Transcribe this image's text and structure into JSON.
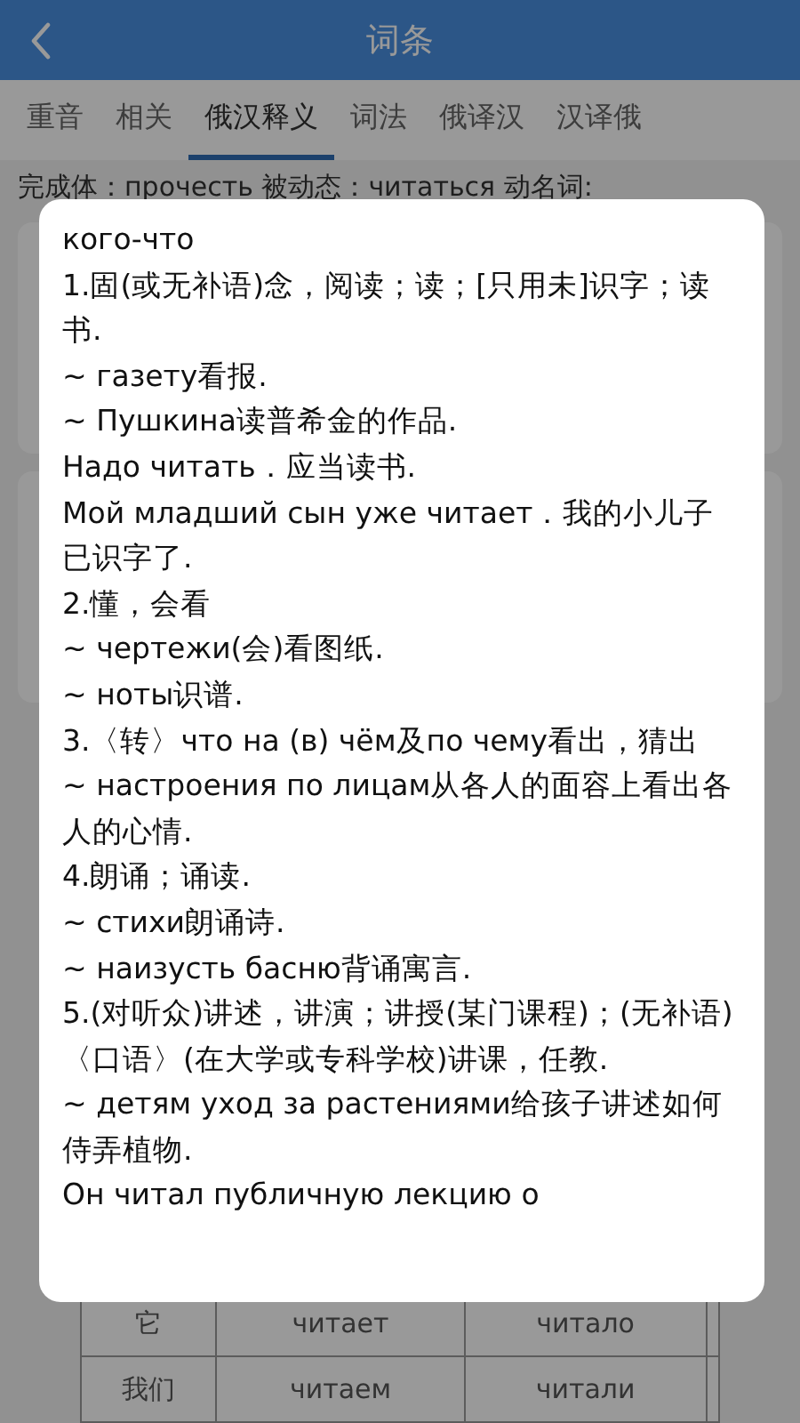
{
  "header": {
    "title": "词条"
  },
  "tabs": [
    {
      "label": "重音",
      "selected": false
    },
    {
      "label": "相关",
      "selected": false
    },
    {
      "label": "俄汉释义",
      "selected": true
    },
    {
      "label": "词法",
      "selected": false
    },
    {
      "label": "俄译汉",
      "selected": false
    },
    {
      "label": "汉译俄",
      "selected": false
    }
  ],
  "forms_line": "完成体：прочесть 被动态：читаться 动名词:",
  "conjugation_table": {
    "rows": [
      [
        "它",
        "читает",
        "читало",
        ""
      ],
      [
        "我们",
        "читаем",
        "читали",
        ""
      ]
    ]
  },
  "dialog": {
    "lines": [
      "кого-что",
      "1.固(或无补语)念，阅读；读；[只用未]识字；读书.",
      "~ газету看报.",
      "~ Пушкина读普希金的作品.",
      "Надо читать．应当读书.",
      "Мой младший сын уже читает．我的小儿子已识字了.",
      "2.懂，会看",
      "~ чертежи(会)看图纸.",
      "~ ноты识谱.",
      "3.〈转〉что на (в) чём及по чему看出，猜出",
      "~ настроения по лицам从各人的面容上看出各人的心情.",
      "4.朗诵；诵读.",
      "~ стихи朗诵诗.",
      "~ наизусть басню背诵寓言.",
      "5.(对听众)讲述，讲演；讲授(某门课程)；(无补语)〈口语〉(在大学或专科学校)讲课，任教.",
      "~ детям уход за растениями给孩子讲述如何侍弄植物.",
      "Он читал публичную лекцию о"
    ]
  }
}
